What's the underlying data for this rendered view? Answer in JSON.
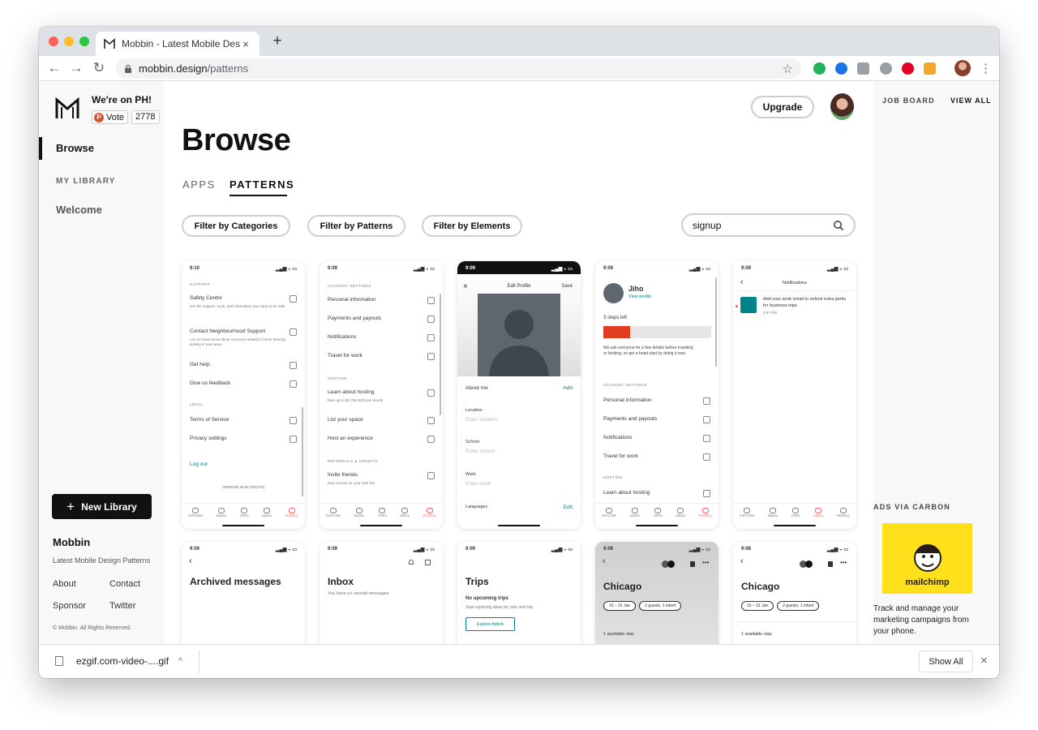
{
  "browser": {
    "tab_title": "Mobbin - Latest Mobile Design P",
    "tab_close": "×",
    "new_tab": "+",
    "url_host": "mobbin.design",
    "url_path": "/patterns",
    "back": "←",
    "forward": "→",
    "reload": "↻",
    "bookmark_star": "☆",
    "menu": "⋮",
    "extension_colors": [
      "#20b15a",
      "#1a73e8",
      "#9aa0a6",
      "#9aa0a6",
      "#e60023",
      "#f4a52a"
    ]
  },
  "sidebar": {
    "ph_title": "We're on PH!",
    "ph_vote": "Vote",
    "ph_count": "2778",
    "ph_badge": "P",
    "browse": "Browse",
    "my_library": "MY LIBRARY",
    "welcome": "Welcome",
    "new_library_plus": "+",
    "new_library": "New Library",
    "brand": "Mobbin",
    "tagline": "Latest Mobile Design Patterns",
    "about": "About",
    "contact": "Contact",
    "sponsor": "Sponsor",
    "twitter": "Twitter",
    "copyright": "© Mobbin. All Rights Reserved."
  },
  "main": {
    "upgrade": "Upgrade",
    "heading": "Browse",
    "tab_apps": "APPS",
    "tab_patterns": "PATTERNS",
    "filter_categories": "Filter by Categories",
    "filter_patterns": "Filter by Patterns",
    "filter_elements": "Filter by Elements",
    "search_value": "signup"
  },
  "rail": {
    "job_board": "JOB BOARD",
    "view_all": "VIEW ALL",
    "ads_label": "ADS VIA CARBON",
    "ad_brand": "mailchimp",
    "ad_text": "Track and manage your marketing campaigns from your phone."
  },
  "tabbar_labels": [
    "EXPLORE",
    "SAVED",
    "TRIPS",
    "INBOX",
    "PROFILE"
  ],
  "cards": {
    "c1": {
      "time": "9:10",
      "support": "SUPPORT",
      "safety": "Safety Centre",
      "safety_sub": "Get the support, tools, and information you need to be safe.",
      "contact": "Contact Neighbourhood Support",
      "contact_sub": "Let our team know about concerns related to home sharing activity in your area.",
      "help": "Get help",
      "feedback": "Give us feedback",
      "legal": "LEGAL",
      "terms": "Terms of Service",
      "privacy": "Privacy settings",
      "logout": "Log out",
      "version": "VERSION 20.02 (001273)"
    },
    "c2": {
      "time": "9:09",
      "account": "ACCOUNT SETTINGS",
      "personal": "Personal information",
      "payments": "Payments and payouts",
      "notifications": "Notifications",
      "travel": "Travel for work",
      "hosting": "HOSTING",
      "learn": "Learn about hosting",
      "learn_sub": "Earn up to $2,768 SGD per month",
      "list": "List your space",
      "host_exp": "Host an experience",
      "referrals": "REFERRALS & CREDITS",
      "invite": "Invite friends",
      "invite_sub": "Earn money for your next trip"
    },
    "c3": {
      "time": "9:09",
      "close": "×",
      "title": "Edit Profile",
      "save": "Save",
      "about": "About me",
      "add": "Add",
      "location": "Location",
      "location_ph": "Enter location",
      "school": "School",
      "school_ph": "Enter school",
      "work": "Work",
      "work_ph": "Enter work",
      "languages": "Languages",
      "edit": "Edit"
    },
    "c4": {
      "time": "9:09",
      "name": "Jiho",
      "view": "View profile",
      "steps": "3 steps left",
      "progress": 0.25,
      "desc": "We ask everyone for a few details before traveling or hosting, so get a head start by doing it now.",
      "account": "ACCOUNT SETTINGS",
      "personal": "Personal information",
      "payments": "Payments and payouts",
      "notifications": "Notifications",
      "travel": "Travel for work",
      "hosting": "HOSTING",
      "learn": "Learn about hosting"
    },
    "c5": {
      "time": "9:09",
      "back": "‹",
      "title": "Notifications",
      "msg": "Add your work email to unlock extra perks for business trips.",
      "msg_time": "8:57 PM"
    },
    "c6": {
      "time": "9:09",
      "back": "‹",
      "title": "Archived messages"
    },
    "c7": {
      "time": "9:09",
      "title": "Inbox",
      "sub": "You have no unread messages"
    },
    "c8": {
      "time": "9:09",
      "title": "Trips",
      "none": "No upcoming trips",
      "sub": "Start exploring ideas for your next trip",
      "btn": "Explore Airbnb"
    },
    "c9": {
      "time": "9:08",
      "back": "‹",
      "city": "Chicago",
      "dates": "15 – 31 Jan",
      "guests": "2 guests, 1 infant",
      "stay": "1 available stay"
    },
    "c10": {
      "time": "9:08",
      "back": "‹",
      "city": "Chicago",
      "dates": "15 – 31 Jan",
      "guests": "2 guests, 1 infant",
      "stay": "1 available stay"
    }
  },
  "download": {
    "file": "ezgif.com-video-....gif",
    "chevron": "^",
    "show_all": "Show All",
    "close": "×"
  }
}
